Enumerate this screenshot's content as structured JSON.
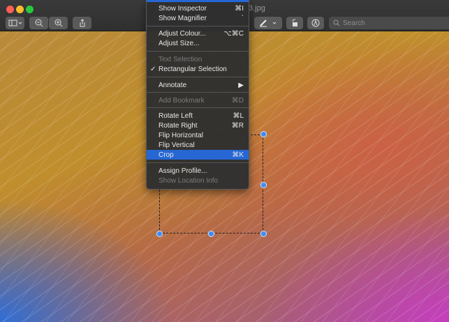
{
  "window": {
    "title_fragment": "3.jpg"
  },
  "toolbar": {
    "search_placeholder": "Search"
  },
  "menu": {
    "items": [
      {
        "label": "Show Inspector",
        "shortcut": "⌘I"
      },
      {
        "label": "Show Magnifier",
        "shortcut": "`"
      },
      {
        "label": "Adjust Colour...",
        "shortcut": "⌥⌘C"
      },
      {
        "label": "Adjust Size...",
        "shortcut": ""
      },
      {
        "label": "Text Selection",
        "shortcut": ""
      },
      {
        "label": "Rectangular Selection",
        "shortcut": "",
        "checked": true,
        "check": "✓"
      },
      {
        "label": "Annotate",
        "shortcut": "▶"
      },
      {
        "label": "Add Bookmark",
        "shortcut": "⌘D"
      },
      {
        "label": "Rotate Left",
        "shortcut": "⌘L"
      },
      {
        "label": "Rotate Right",
        "shortcut": "⌘R"
      },
      {
        "label": "Flip Horizontal",
        "shortcut": ""
      },
      {
        "label": "Flip Vertical",
        "shortcut": ""
      },
      {
        "label": "Crop",
        "shortcut": "⌘K",
        "selected": true
      },
      {
        "label": "Assign Profile...",
        "shortcut": ""
      },
      {
        "label": "Show Location Info",
        "shortcut": ""
      }
    ]
  },
  "colors": {
    "accent": "#2767d4",
    "handle": "#3d8cf5"
  }
}
